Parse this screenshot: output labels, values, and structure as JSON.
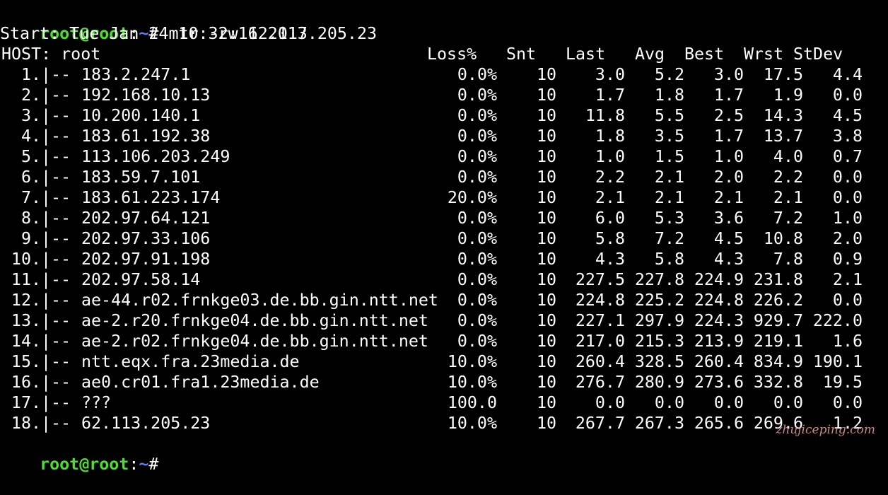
{
  "prompt": {
    "user_host": "root@root",
    "separator": ":",
    "path": "~",
    "symbol": "#",
    "command": " mtr -rw 62.113.205.23"
  },
  "start_line": "Start: Tue Jan 24 10:32:11 2017",
  "header": {
    "host": "HOST: root",
    "loss": "Loss%",
    "snt": "Snt",
    "last": "Last",
    "avg": "Avg",
    "best": "Best",
    "wrst": "Wrst",
    "stdev": "StDev"
  },
  "hops": [
    {
      "idx": "1.",
      "sep": "|--",
      "host": "183.2.247.1",
      "loss": "0.0%",
      "snt": "10",
      "last": "3.0",
      "avg": "5.2",
      "best": "3.0",
      "wrst": "17.5",
      "stdev": "4.4"
    },
    {
      "idx": "2.",
      "sep": "|--",
      "host": "192.168.10.13",
      "loss": "0.0%",
      "snt": "10",
      "last": "1.7",
      "avg": "1.8",
      "best": "1.7",
      "wrst": "1.9",
      "stdev": "0.0"
    },
    {
      "idx": "3.",
      "sep": "|--",
      "host": "10.200.140.1",
      "loss": "0.0%",
      "snt": "10",
      "last": "11.8",
      "avg": "5.5",
      "best": "2.5",
      "wrst": "14.3",
      "stdev": "4.5"
    },
    {
      "idx": "4.",
      "sep": "|--",
      "host": "183.61.192.38",
      "loss": "0.0%",
      "snt": "10",
      "last": "1.8",
      "avg": "3.5",
      "best": "1.7",
      "wrst": "13.7",
      "stdev": "3.8"
    },
    {
      "idx": "5.",
      "sep": "|--",
      "host": "113.106.203.249",
      "loss": "0.0%",
      "snt": "10",
      "last": "1.0",
      "avg": "1.5",
      "best": "1.0",
      "wrst": "4.0",
      "stdev": "0.7"
    },
    {
      "idx": "6.",
      "sep": "|--",
      "host": "183.59.7.101",
      "loss": "0.0%",
      "snt": "10",
      "last": "2.2",
      "avg": "2.1",
      "best": "2.0",
      "wrst": "2.2",
      "stdev": "0.0"
    },
    {
      "idx": "7.",
      "sep": "|--",
      "host": "183.61.223.174",
      "loss": "20.0%",
      "snt": "10",
      "last": "2.1",
      "avg": "2.1",
      "best": "2.1",
      "wrst": "2.1",
      "stdev": "0.0"
    },
    {
      "idx": "8.",
      "sep": "|--",
      "host": "202.97.64.121",
      "loss": "0.0%",
      "snt": "10",
      "last": "6.0",
      "avg": "5.3",
      "best": "3.6",
      "wrst": "7.2",
      "stdev": "1.0"
    },
    {
      "idx": "9.",
      "sep": "|--",
      "host": "202.97.33.106",
      "loss": "0.0%",
      "snt": "10",
      "last": "5.8",
      "avg": "7.2",
      "best": "4.5",
      "wrst": "10.8",
      "stdev": "2.0"
    },
    {
      "idx": "10.",
      "sep": "|--",
      "host": "202.97.91.198",
      "loss": "0.0%",
      "snt": "10",
      "last": "4.3",
      "avg": "5.8",
      "best": "4.3",
      "wrst": "7.8",
      "stdev": "0.9"
    },
    {
      "idx": "11.",
      "sep": "|--",
      "host": "202.97.58.14",
      "loss": "0.0%",
      "snt": "10",
      "last": "227.5",
      "avg": "227.8",
      "best": "224.9",
      "wrst": "231.8",
      "stdev": "2.1"
    },
    {
      "idx": "12.",
      "sep": "|--",
      "host": "ae-44.r02.frnkge03.de.bb.gin.ntt.net",
      "loss": "0.0%",
      "snt": "10",
      "last": "224.8",
      "avg": "225.2",
      "best": "224.8",
      "wrst": "226.2",
      "stdev": "0.0"
    },
    {
      "idx": "13.",
      "sep": "|--",
      "host": "ae-2.r20.frnkge04.de.bb.gin.ntt.net",
      "loss": "0.0%",
      "snt": "10",
      "last": "227.1",
      "avg": "297.9",
      "best": "224.3",
      "wrst": "929.7",
      "stdev": "222.0"
    },
    {
      "idx": "14.",
      "sep": "|--",
      "host": "ae-2.r02.frnkge04.de.bb.gin.ntt.net",
      "loss": "0.0%",
      "snt": "10",
      "last": "217.0",
      "avg": "215.3",
      "best": "213.9",
      "wrst": "219.1",
      "stdev": "1.6"
    },
    {
      "idx": "15.",
      "sep": "|--",
      "host": "ntt.eqx.fra.23media.de",
      "loss": "10.0%",
      "snt": "10",
      "last": "260.4",
      "avg": "328.5",
      "best": "260.4",
      "wrst": "834.9",
      "stdev": "190.1"
    },
    {
      "idx": "16.",
      "sep": "|--",
      "host": "ae0.cr01.fra1.23media.de",
      "loss": "10.0%",
      "snt": "10",
      "last": "276.7",
      "avg": "280.9",
      "best": "273.6",
      "wrst": "332.8",
      "stdev": "19.5"
    },
    {
      "idx": "17.",
      "sep": "|--",
      "host": "???",
      "loss": "100.0",
      "snt": "10",
      "last": "0.0",
      "avg": "0.0",
      "best": "0.0",
      "wrst": "0.0",
      "stdev": "0.0"
    },
    {
      "idx": "18.",
      "sep": "|--",
      "host": "62.113.205.23",
      "loss": "10.0%",
      "snt": "10",
      "last": "267.7",
      "avg": "267.3",
      "best": "265.6",
      "wrst": "269.6",
      "stdev": "1.2"
    }
  ],
  "final_prompt": {
    "user_host": "root@root",
    "separator": ":",
    "path": "~",
    "symbol": "#"
  },
  "watermark": "zhujiceping.com",
  "colors": {
    "background": "#000000",
    "text": "#ffffff",
    "prompt_user": "#4dde2e",
    "prompt_path": "#5b7cff"
  }
}
